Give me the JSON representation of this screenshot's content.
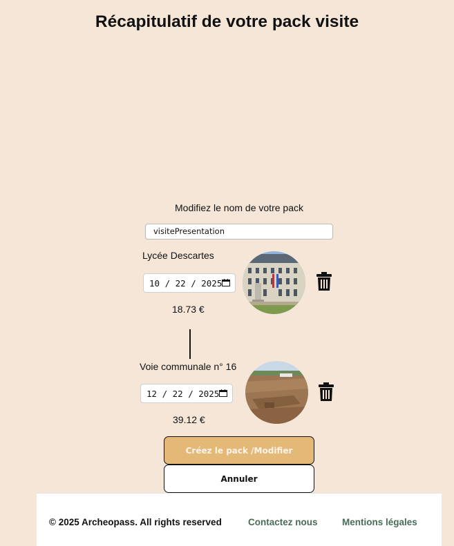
{
  "page": {
    "title": "Récapitulatif de votre pack visite"
  },
  "pack": {
    "name_label": "Modifiez le nom de votre pack",
    "name_value": "visitePresentation"
  },
  "items": [
    {
      "name": "Lycée Descartes",
      "date": "10 / 22 / 2025",
      "price": "18.73 €",
      "icons": [
        "calendar-icon",
        "trash-icon"
      ]
    },
    {
      "name": "Voie communale n° 16",
      "date": "12 / 22 / 2025",
      "price": "39.12 €",
      "icons": [
        "calendar-icon",
        "trash-icon"
      ]
    }
  ],
  "actions": {
    "create_label": "Créez le pack /Modifier",
    "cancel_label": "Annuler"
  },
  "footer": {
    "copyright": "© 2025 Archeopass. All rights reserved",
    "contact": "Contactez nous",
    "legal": "Mentions légales"
  },
  "colors": {
    "background": "#f5e6d8",
    "create_button": "#e4b978",
    "footer_link": "#4a6b55"
  }
}
